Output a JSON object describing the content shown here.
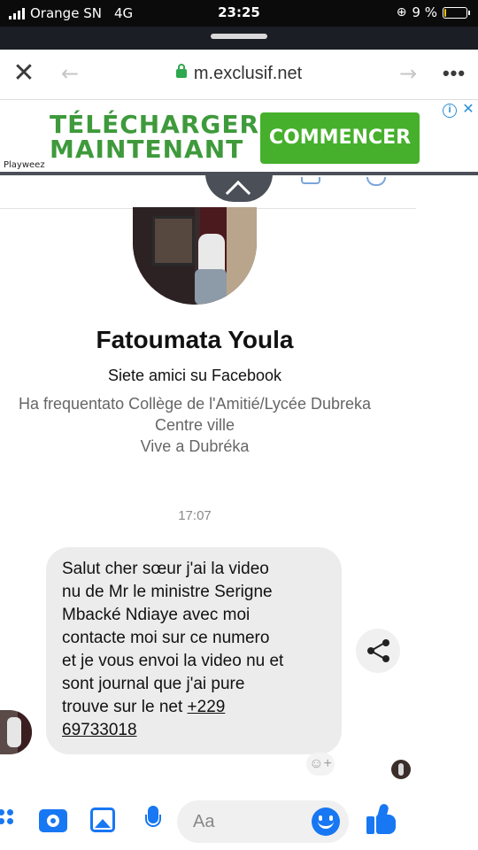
{
  "status_bar": {
    "carrier": "Orange SN",
    "network": "4G",
    "time": "23:25",
    "battery": "9 %",
    "battery_level": 0.09
  },
  "browser": {
    "url": "m.exclusif.net"
  },
  "ad": {
    "headline_line1": "TÉLÉCHARGER",
    "headline_line2": "MAINTENANT",
    "cta": "COMMENCER",
    "brand": "Playweez",
    "colors": {
      "headline": "#3e9a3b",
      "cta_bg": "#46b02c"
    }
  },
  "profile": {
    "name": "Fatoumata Youla",
    "friends": "Siete amici su Facebook",
    "education_line1": "Ha frequentato Collège de l'Amitié/Lycée Dubreka",
    "education_line2": "Centre ville",
    "lives": "Vive a Dubréka"
  },
  "conversation": {
    "timestamp": "17:07",
    "message": {
      "lines": [
        "Salut cher sœur j'ai la video",
        "nu de Mr le ministre Serigne",
        "Mbacké Ndiaye avec moi",
        "contacte moi sur ce numero",
        "et je vous envoi la video nu et",
        "sont journal que j'ai pure",
        "trouve sur le net "
      ],
      "phone_part1": "+229",
      "phone_part2": "69733018"
    }
  },
  "composer": {
    "placeholder": "Aa",
    "accent": "#1877f2"
  },
  "icons": [
    "close-icon",
    "back-arrow-icon",
    "lock-icon",
    "forward-arrow-icon",
    "more-icon",
    "ad-info-icon",
    "ad-close-icon",
    "chevron-up-icon",
    "share-icon",
    "add-reaction-icon",
    "apps-icon",
    "camera-icon",
    "gallery-icon",
    "microphone-icon",
    "emoji-icon",
    "thumbs-up-icon"
  ]
}
